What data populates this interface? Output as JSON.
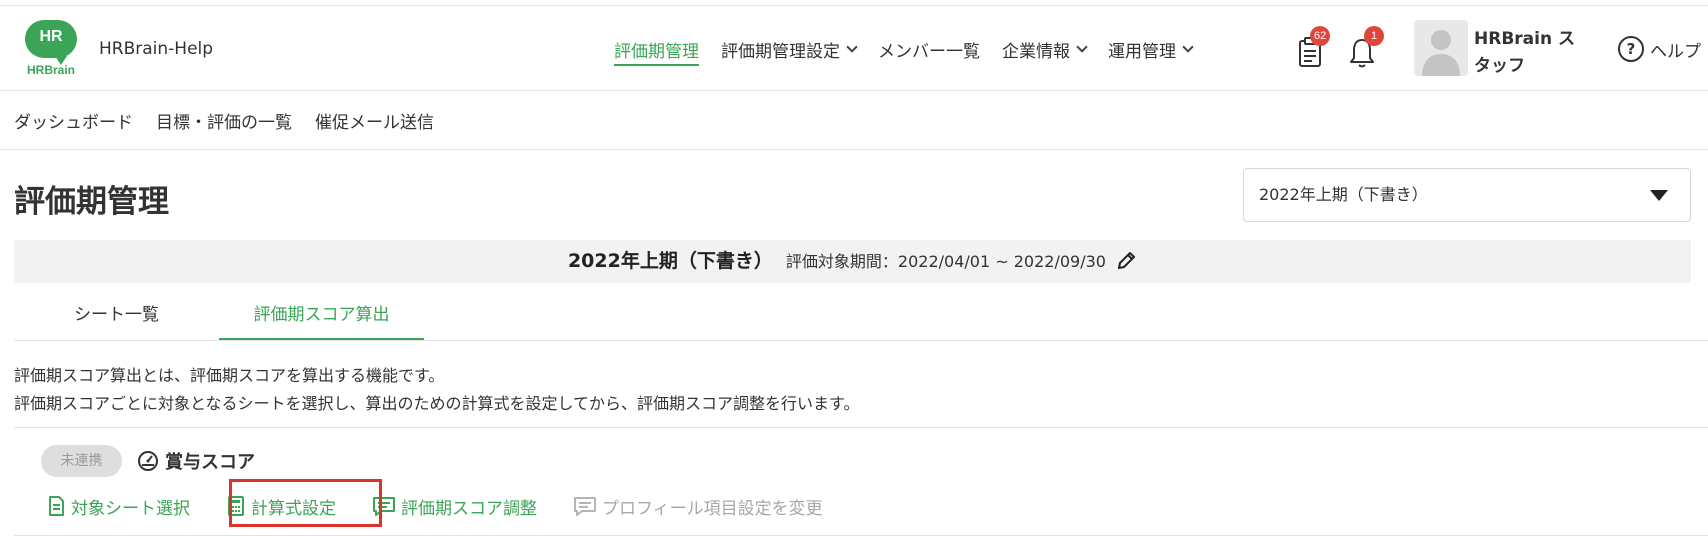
{
  "header": {
    "logo_text": "HR",
    "logo_word": "HRBrain",
    "app_title": "HRBrain-Help",
    "nav": [
      {
        "label": "評価期管理",
        "active": true,
        "dropdown": false
      },
      {
        "label": "評価期管理設定",
        "active": false,
        "dropdown": true
      },
      {
        "label": "メンバー一覧",
        "active": false,
        "dropdown": false
      },
      {
        "label": "企業情報",
        "active": false,
        "dropdown": true
      },
      {
        "label": "運用管理",
        "active": false,
        "dropdown": true
      }
    ],
    "notifications": {
      "clipboard_count": "62",
      "bell_count": "1"
    },
    "user_name": "HRBrain スタッフ",
    "help_icon": "?",
    "help_label": "ヘルプ"
  },
  "subnav": [
    "ダッシュボード",
    "目標・評価の一覧",
    "催促メール送信"
  ],
  "page_title": "評価期管理",
  "period_select": {
    "value": "2022年上期（下書き）"
  },
  "period_bar": {
    "name": "2022年上期（下書き）",
    "range": "評価対象期間：2022/04/01 ~ 2022/09/30"
  },
  "tabs": [
    {
      "label": "シート一覧",
      "active": false
    },
    {
      "label": "評価期スコア算出",
      "active": true
    }
  ],
  "description": [
    "評価期スコア算出とは、評価期スコアを算出する機能です。",
    "評価期スコアごとに対象となるシートを選択し、算出のための計算式を設定してから、評価期スコア調整を行います。"
  ],
  "score": {
    "status": "未連携",
    "title": "賞与スコア",
    "actions": [
      {
        "label": "対象シート選択",
        "icon": "document-icon",
        "enabled": true
      },
      {
        "label": "計算式設定",
        "icon": "calculator-icon",
        "enabled": true,
        "highlighted": true
      },
      {
        "label": "評価期スコア調整",
        "icon": "comment-icon",
        "enabled": true
      },
      {
        "label": "プロフィール項目設定を変更",
        "icon": "comment-icon",
        "enabled": false
      }
    ]
  },
  "colors": {
    "accent": "#3aa556",
    "badge": "#e0473c",
    "highlight": "#d9342b"
  }
}
